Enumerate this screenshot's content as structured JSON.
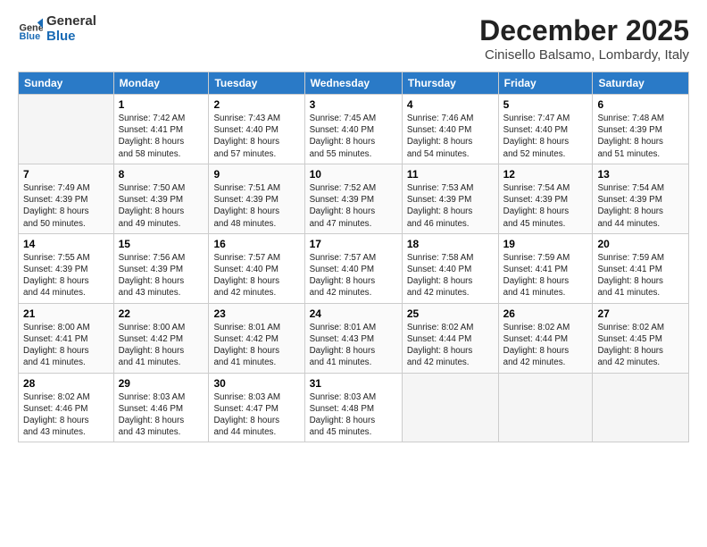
{
  "header": {
    "logo_line1": "General",
    "logo_line2": "Blue",
    "month": "December 2025",
    "location": "Cinisello Balsamo, Lombardy, Italy"
  },
  "weekdays": [
    "Sunday",
    "Monday",
    "Tuesday",
    "Wednesday",
    "Thursday",
    "Friday",
    "Saturday"
  ],
  "weeks": [
    [
      {
        "day": "",
        "text": ""
      },
      {
        "day": "1",
        "text": "Sunrise: 7:42 AM\nSunset: 4:41 PM\nDaylight: 8 hours\nand 58 minutes."
      },
      {
        "day": "2",
        "text": "Sunrise: 7:43 AM\nSunset: 4:40 PM\nDaylight: 8 hours\nand 57 minutes."
      },
      {
        "day": "3",
        "text": "Sunrise: 7:45 AM\nSunset: 4:40 PM\nDaylight: 8 hours\nand 55 minutes."
      },
      {
        "day": "4",
        "text": "Sunrise: 7:46 AM\nSunset: 4:40 PM\nDaylight: 8 hours\nand 54 minutes."
      },
      {
        "day": "5",
        "text": "Sunrise: 7:47 AM\nSunset: 4:40 PM\nDaylight: 8 hours\nand 52 minutes."
      },
      {
        "day": "6",
        "text": "Sunrise: 7:48 AM\nSunset: 4:39 PM\nDaylight: 8 hours\nand 51 minutes."
      }
    ],
    [
      {
        "day": "7",
        "text": "Sunrise: 7:49 AM\nSunset: 4:39 PM\nDaylight: 8 hours\nand 50 minutes."
      },
      {
        "day": "8",
        "text": "Sunrise: 7:50 AM\nSunset: 4:39 PM\nDaylight: 8 hours\nand 49 minutes."
      },
      {
        "day": "9",
        "text": "Sunrise: 7:51 AM\nSunset: 4:39 PM\nDaylight: 8 hours\nand 48 minutes."
      },
      {
        "day": "10",
        "text": "Sunrise: 7:52 AM\nSunset: 4:39 PM\nDaylight: 8 hours\nand 47 minutes."
      },
      {
        "day": "11",
        "text": "Sunrise: 7:53 AM\nSunset: 4:39 PM\nDaylight: 8 hours\nand 46 minutes."
      },
      {
        "day": "12",
        "text": "Sunrise: 7:54 AM\nSunset: 4:39 PM\nDaylight: 8 hours\nand 45 minutes."
      },
      {
        "day": "13",
        "text": "Sunrise: 7:54 AM\nSunset: 4:39 PM\nDaylight: 8 hours\nand 44 minutes."
      }
    ],
    [
      {
        "day": "14",
        "text": "Sunrise: 7:55 AM\nSunset: 4:39 PM\nDaylight: 8 hours\nand 44 minutes."
      },
      {
        "day": "15",
        "text": "Sunrise: 7:56 AM\nSunset: 4:39 PM\nDaylight: 8 hours\nand 43 minutes."
      },
      {
        "day": "16",
        "text": "Sunrise: 7:57 AM\nSunset: 4:40 PM\nDaylight: 8 hours\nand 42 minutes."
      },
      {
        "day": "17",
        "text": "Sunrise: 7:57 AM\nSunset: 4:40 PM\nDaylight: 8 hours\nand 42 minutes."
      },
      {
        "day": "18",
        "text": "Sunrise: 7:58 AM\nSunset: 4:40 PM\nDaylight: 8 hours\nand 42 minutes."
      },
      {
        "day": "19",
        "text": "Sunrise: 7:59 AM\nSunset: 4:41 PM\nDaylight: 8 hours\nand 41 minutes."
      },
      {
        "day": "20",
        "text": "Sunrise: 7:59 AM\nSunset: 4:41 PM\nDaylight: 8 hours\nand 41 minutes."
      }
    ],
    [
      {
        "day": "21",
        "text": "Sunrise: 8:00 AM\nSunset: 4:41 PM\nDaylight: 8 hours\nand 41 minutes."
      },
      {
        "day": "22",
        "text": "Sunrise: 8:00 AM\nSunset: 4:42 PM\nDaylight: 8 hours\nand 41 minutes."
      },
      {
        "day": "23",
        "text": "Sunrise: 8:01 AM\nSunset: 4:42 PM\nDaylight: 8 hours\nand 41 minutes."
      },
      {
        "day": "24",
        "text": "Sunrise: 8:01 AM\nSunset: 4:43 PM\nDaylight: 8 hours\nand 41 minutes."
      },
      {
        "day": "25",
        "text": "Sunrise: 8:02 AM\nSunset: 4:44 PM\nDaylight: 8 hours\nand 42 minutes."
      },
      {
        "day": "26",
        "text": "Sunrise: 8:02 AM\nSunset: 4:44 PM\nDaylight: 8 hours\nand 42 minutes."
      },
      {
        "day": "27",
        "text": "Sunrise: 8:02 AM\nSunset: 4:45 PM\nDaylight: 8 hours\nand 42 minutes."
      }
    ],
    [
      {
        "day": "28",
        "text": "Sunrise: 8:02 AM\nSunset: 4:46 PM\nDaylight: 8 hours\nand 43 minutes."
      },
      {
        "day": "29",
        "text": "Sunrise: 8:03 AM\nSunset: 4:46 PM\nDaylight: 8 hours\nand 43 minutes."
      },
      {
        "day": "30",
        "text": "Sunrise: 8:03 AM\nSunset: 4:47 PM\nDaylight: 8 hours\nand 44 minutes."
      },
      {
        "day": "31",
        "text": "Sunrise: 8:03 AM\nSunset: 4:48 PM\nDaylight: 8 hours\nand 45 minutes."
      },
      {
        "day": "",
        "text": ""
      },
      {
        "day": "",
        "text": ""
      },
      {
        "day": "",
        "text": ""
      }
    ]
  ]
}
